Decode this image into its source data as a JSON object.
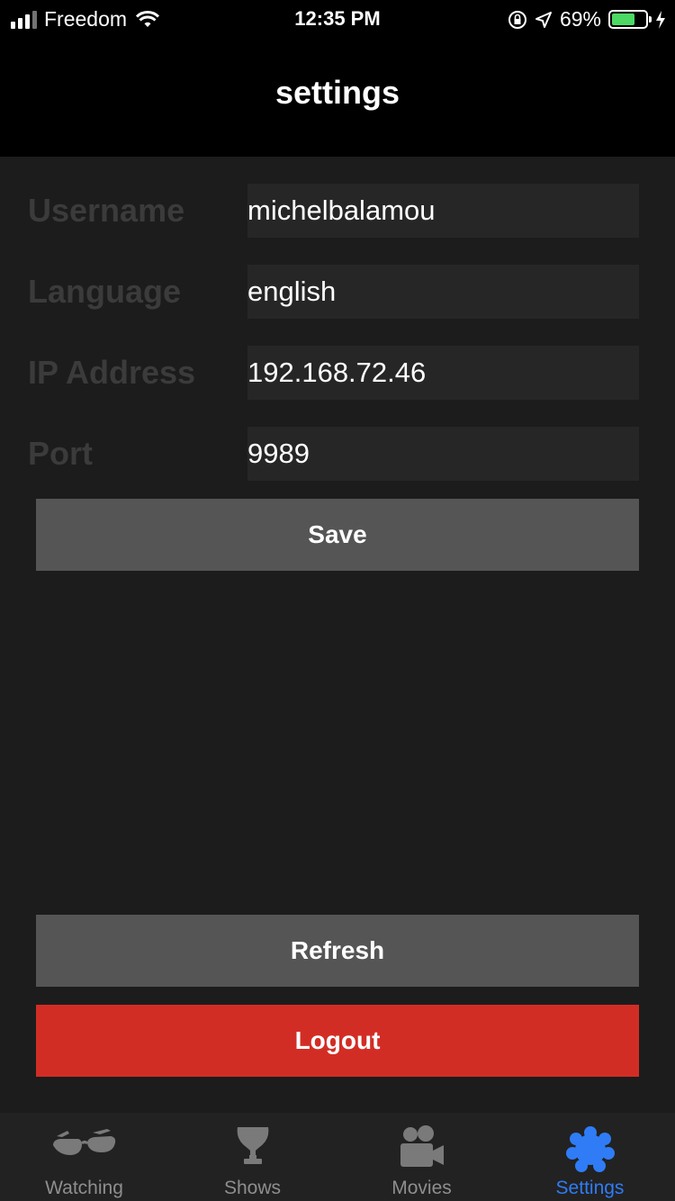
{
  "status_bar": {
    "carrier": "Freedom",
    "time": "12:35 PM",
    "battery_percent": "69%",
    "battery_level": 0.69,
    "battery_color": "#4cd964"
  },
  "header": {
    "title": "settings"
  },
  "form": {
    "fields": [
      {
        "label": "Username",
        "value": "michelbalamou"
      },
      {
        "label": "Language",
        "value": "english"
      },
      {
        "label": "IP Address",
        "value": "192.168.72.46"
      },
      {
        "label": "Port",
        "value": "9989"
      }
    ],
    "save_label": "Save"
  },
  "actions": {
    "refresh_label": "Refresh",
    "logout_label": "Logout",
    "logout_color": "#d22d25"
  },
  "tabbar": {
    "tabs": [
      {
        "label": "Watching",
        "icon": "glasses-icon"
      },
      {
        "label": "Shows",
        "icon": "trophy-icon"
      },
      {
        "label": "Movies",
        "icon": "camera-icon"
      },
      {
        "label": "Settings",
        "icon": "gear-icon",
        "active": true
      }
    ],
    "active_color": "#2f7cf6",
    "inactive_color": "#8e8e8e"
  }
}
